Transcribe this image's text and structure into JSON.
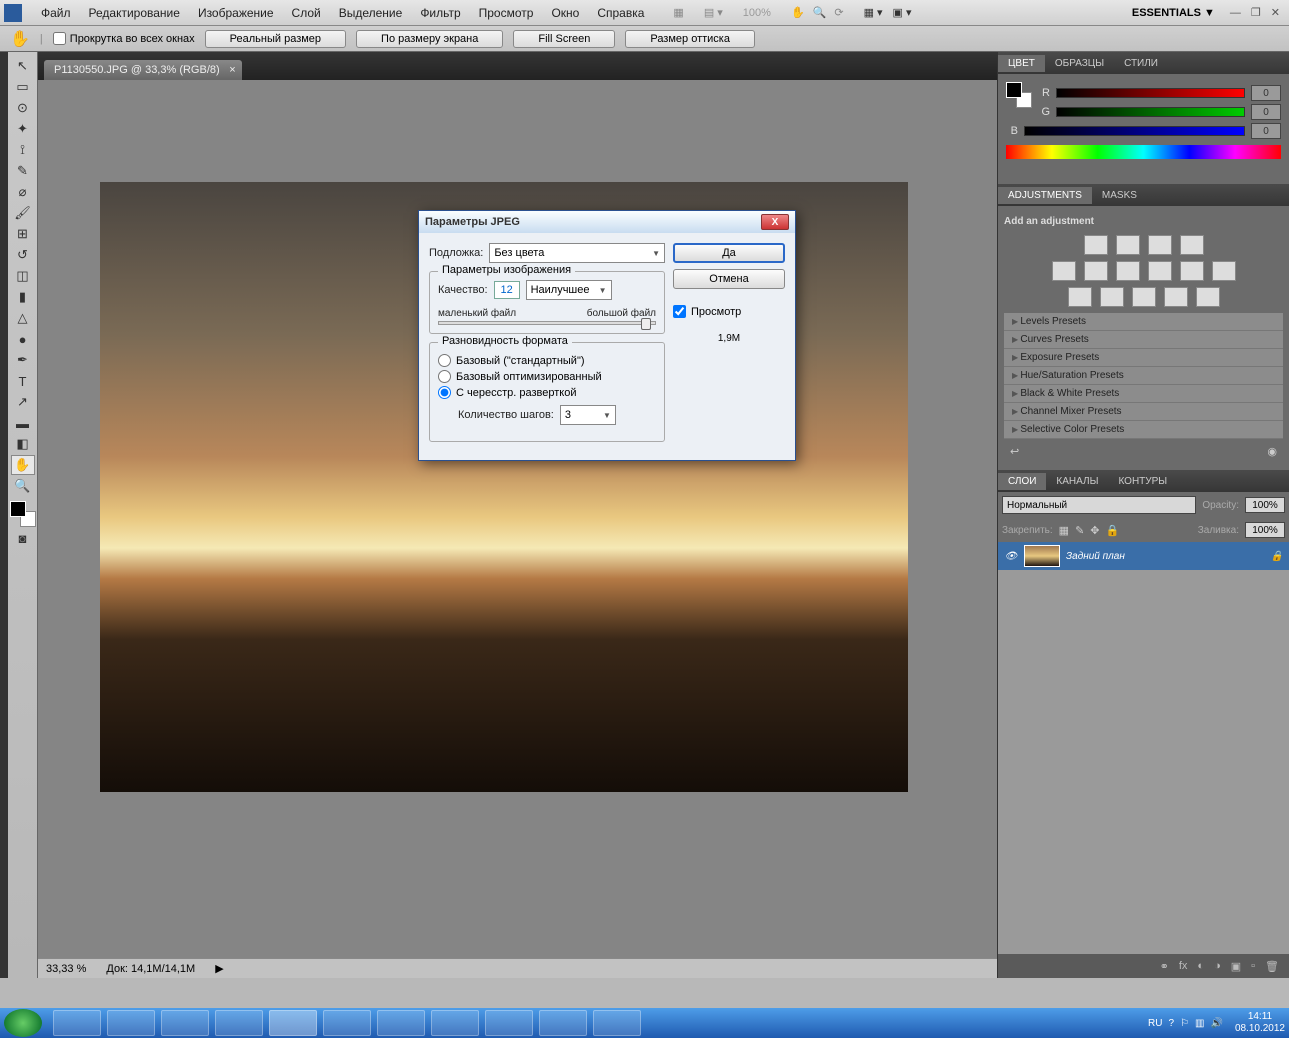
{
  "menu": [
    "Файл",
    "Редактирование",
    "Изображение",
    "Слой",
    "Выделение",
    "Фильтр",
    "Просмотр",
    "Окно",
    "Справка"
  ],
  "top_right": {
    "workspace": "ESSENTIALS",
    "zoom": "100%"
  },
  "options": {
    "scroll_all": "Прокрутка во всех окнах",
    "buttons": [
      "Реальный размер",
      "По размеру экрана",
      "Fill Screen",
      "Размер оттиска"
    ]
  },
  "doc_tab": "P1130550.JPG @ 33,3% (RGB/8)",
  "status": {
    "zoom": "33,33 %",
    "doc": "Док: 14,1M/14,1M"
  },
  "panels": {
    "color": {
      "tabs": [
        "ЦВЕТ",
        "ОБРАЗЦЫ",
        "СТИЛИ"
      ],
      "channels": [
        "R",
        "G",
        "B"
      ],
      "vals": [
        "0",
        "0",
        "0"
      ]
    },
    "adjust": {
      "tabs": [
        "ADJUSTMENTS",
        "MASKS"
      ],
      "title": "Add an adjustment",
      "presets": [
        "Levels Presets",
        "Curves Presets",
        "Exposure Presets",
        "Hue/Saturation Presets",
        "Black & White Presets",
        "Channel Mixer Presets",
        "Selective Color Presets"
      ]
    },
    "layers": {
      "tabs": [
        "СЛОИ",
        "КАНАЛЫ",
        "КОНТУРЫ"
      ],
      "blend": "Нормальный",
      "opacity_label": "Opacity:",
      "opacity": "100%",
      "lock_label": "Закрепить:",
      "fill_label": "Заливка:",
      "fill": "100%",
      "layer_name": "Задний план"
    }
  },
  "dialog": {
    "title": "Параметры JPEG",
    "matte_label": "Подложка:",
    "matte": "Без цвета",
    "img_legend": "Параметры изображения",
    "quality_label": "Качество:",
    "quality": "12",
    "quality_drop": "Наилучшее",
    "small": "маленький файл",
    "large": "большой файл",
    "fmt_legend": "Разновидность формата",
    "fmt_opts": [
      "Базовый (\"стандартный\")",
      "Базовый оптимизированный",
      "С чересстр. разверткой"
    ],
    "steps_label": "Количество шагов:",
    "steps": "3",
    "ok": "Да",
    "cancel": "Отмена",
    "preview": "Просмотр",
    "size": "1,9M"
  },
  "taskbar": {
    "lang": "RU",
    "time": "14:11",
    "date": "08.10.2012"
  }
}
